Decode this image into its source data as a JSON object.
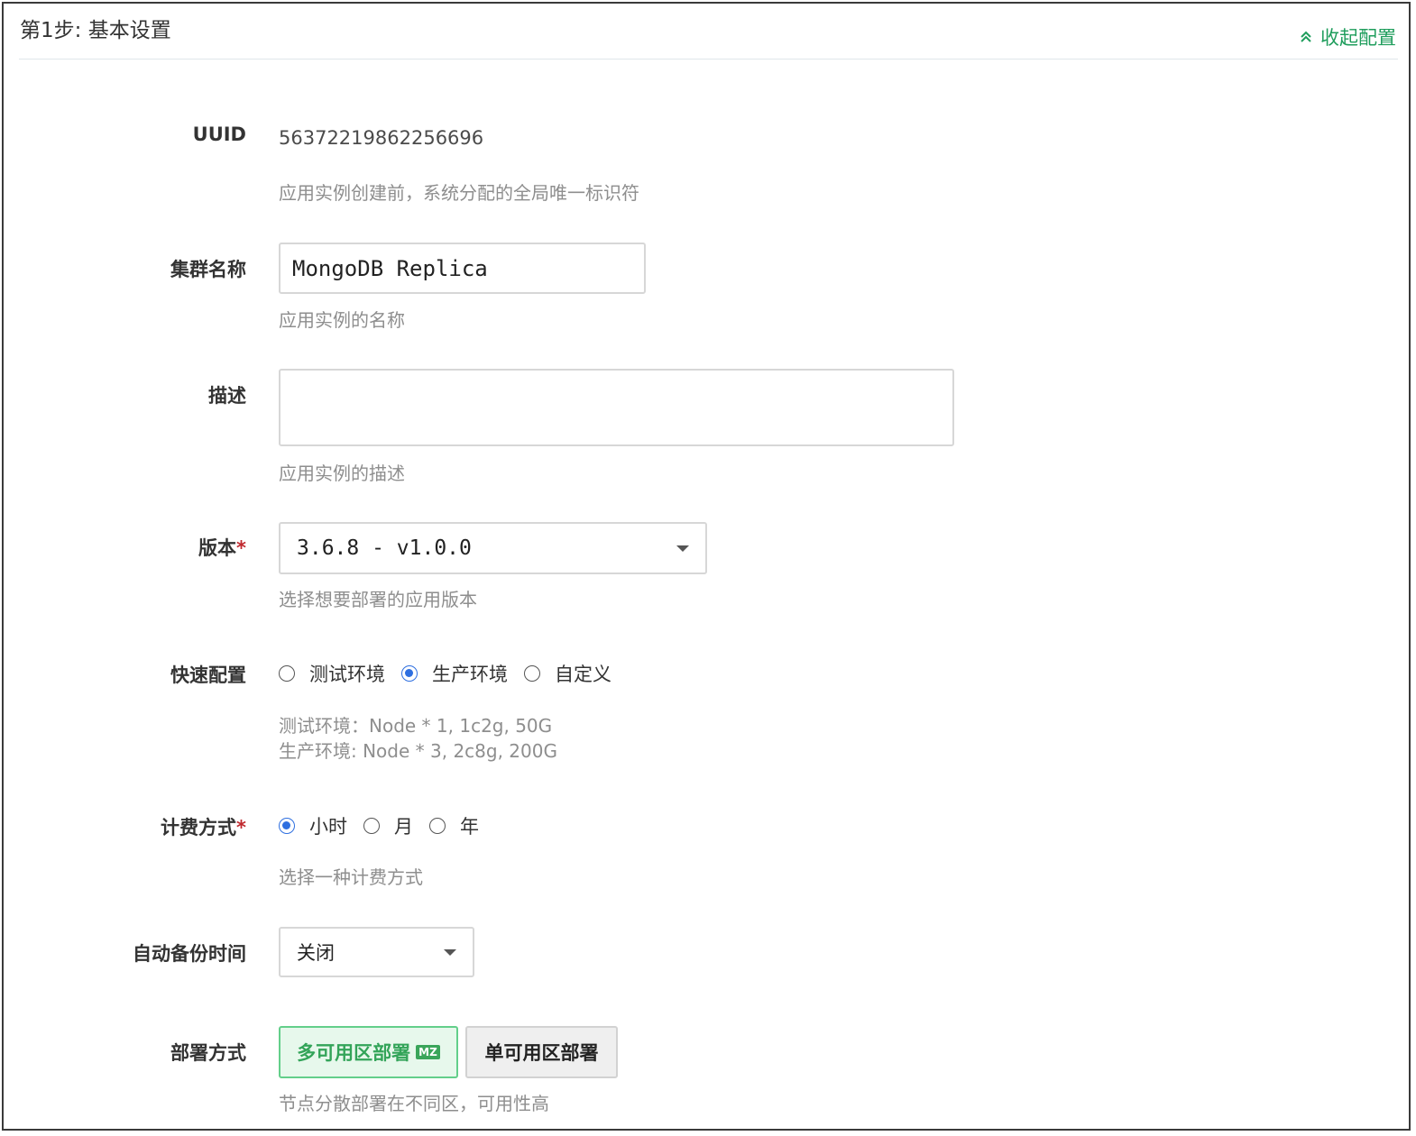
{
  "header": {
    "title": "第1步: 基本设置",
    "collapse_label": "收起配置"
  },
  "uuid": {
    "label": "UUID",
    "value": "56372219862256696",
    "help": "应用实例创建前，系统分配的全局唯一标识符"
  },
  "cluster_name": {
    "label": "集群名称",
    "value": "MongoDB Replica",
    "help": "应用实例的名称"
  },
  "description": {
    "label": "描述",
    "value": "",
    "help": "应用实例的描述"
  },
  "version": {
    "label": "版本",
    "required_mark": "*",
    "value": "3.6.8 - v1.0.0",
    "help": "选择想要部署的应用版本"
  },
  "quick_config": {
    "label": "快速配置",
    "options": [
      {
        "label": "测试环境",
        "checked": false
      },
      {
        "label": "生产环境",
        "checked": true
      },
      {
        "label": "自定义",
        "checked": false
      }
    ],
    "help_lines": [
      "测试环境：Node * 1, 1c2g, 50G",
      "生产环境: Node * 3, 2c8g, 200G"
    ]
  },
  "billing": {
    "label": "计费方式",
    "required_mark": "*",
    "options": [
      {
        "label": "小时",
        "checked": true
      },
      {
        "label": "月",
        "checked": false
      },
      {
        "label": "年",
        "checked": false
      }
    ],
    "help": "选择一种计费方式"
  },
  "auto_backup": {
    "label": "自动备份时间",
    "value": "关闭"
  },
  "deploy_mode": {
    "label": "部署方式",
    "options": [
      {
        "label": "多可用区部署",
        "badge": "MZ",
        "active": true
      },
      {
        "label": "单可用区部署",
        "active": false
      }
    ],
    "help": "节点分散部署在不同区，可用性高"
  },
  "colors": {
    "accent_green": "#1f9d5c",
    "radio_blue": "#2e6fe0",
    "required_red": "#c0282e"
  }
}
